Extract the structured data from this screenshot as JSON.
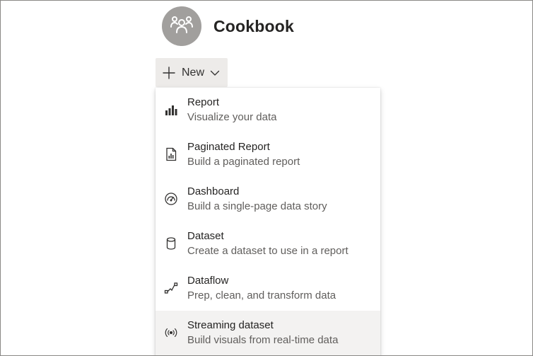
{
  "workspace": {
    "name": "Cookbook",
    "avatar_icon": "people-group-icon"
  },
  "new_button": {
    "label": "New",
    "icon": "plus-icon",
    "dropdown_icon": "chevron-down-icon"
  },
  "menu": {
    "items": [
      {
        "title": "Report",
        "description": "Visualize your data",
        "icon": "bar-chart-icon"
      },
      {
        "title": "Paginated Report",
        "description": "Build a paginated report",
        "icon": "paginated-report-icon"
      },
      {
        "title": "Dashboard",
        "description": "Build a single-page data story",
        "icon": "gauge-icon"
      },
      {
        "title": "Dataset",
        "description": "Create a dataset to use in a report",
        "icon": "database-icon"
      },
      {
        "title": "Dataflow",
        "description": "Prep, clean, and transform data",
        "icon": "dataflow-icon"
      },
      {
        "title": "Streaming dataset",
        "description": "Build visuals from real-time data",
        "icon": "streaming-icon"
      }
    ],
    "highlighted_item": "Streaming dataset"
  },
  "colors": {
    "avatar": "#a19f9d",
    "button_bg": "#edebe9",
    "hover_bg": "#f3f2f1",
    "text_primary": "#252423",
    "text_secondary": "#605e5c"
  }
}
